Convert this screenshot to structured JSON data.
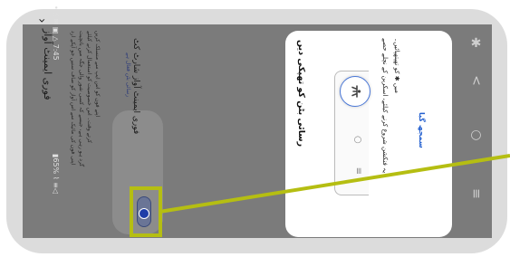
{
  "status_bar": {
    "left": "• ☝ ✉ ▣ △ 7:45",
    "right": "▮65% ⌇ ≡◁"
  },
  "settings_page": {
    "title": "فوری ایمینٹ آواز",
    "back_icon": "chevron-left-icon",
    "description_lines": [
      "اپنی فون کی مائیک سے اس آواز کو صاف سنیں جو آپکے ارد",
      "گرد ہو رہی ہے، جیسے کہ کسی شور والی جگہ میں باتچیت",
      "کرتے وقت۔ اس خصوصیت کو استعمال کرنے کیلئے",
      "اپنے فون کو اس ایپ سے منسلک کریں"
    ],
    "toggle_card": {
      "title": "فوری ایمینٹ آواز شارٹ کٹ",
      "subtitle": "رسائی بٹن فعال ہے",
      "toggle_on": true
    }
  },
  "dialog": {
    "title": "رسائی بٹن کو تھپکی دیں",
    "body_line_1": "یہ فنکشن شروع کرنے کیلئے، اسکرین کے نچلے حصے",
    "body_line_2": "میں ✱ کو تھپتھپائیں۔",
    "link": "سمجھ گیا",
    "illustration_icon": "accessibility-icon"
  },
  "navbar": {
    "icons": [
      "accessibility-icon",
      "recent-apps-icon",
      "home-icon",
      "back-icon"
    ],
    "glyph_accessibility": "✱",
    "glyph_recent": "≡",
    "glyph_home": "○",
    "glyph_back": "<"
  },
  "colors": {
    "highlight": "#b5be12",
    "toggle_on": "#1f3ea8",
    "link": "#2460cf",
    "dim_overlay": "#7b7b7b"
  }
}
